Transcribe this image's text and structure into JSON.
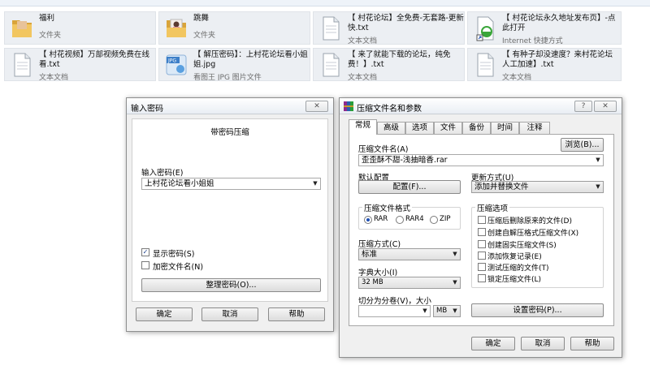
{
  "explorer": {
    "tiles": [
      {
        "name": "福利",
        "type": "文件夹",
        "icon": "folder-icon"
      },
      {
        "name": "跳舞",
        "type": "文件夹",
        "icon": "folder-photo-icon"
      },
      {
        "name": "【 村花论坛】全免费-无套路-更新快.txt",
        "type": "文本文档",
        "icon": "text-file-icon"
      },
      {
        "name": "【 村花论坛永久地址发布页】-点此打开",
        "type": "Internet 快捷方式",
        "icon": "internet-shortcut-icon"
      },
      {
        "name": "【 村花视频】万部视频免费在线看.txt",
        "type": "文本文档",
        "icon": "text-file-icon"
      },
      {
        "name": "【 解压密码】：上村花论坛看小姐姐.jpg",
        "type": "看图王 JPG 图片文件",
        "icon": "jpg-image-icon"
      },
      {
        "name": "【 来了就能下载的论坛，纯免费！】.txt",
        "type": "文本文档",
        "icon": "text-file-icon"
      },
      {
        "name": "【 有种子却没速度？来村花论坛人工加速】.txt",
        "type": "文本文档",
        "icon": "text-file-icon"
      }
    ]
  },
  "password_dialog": {
    "title": "输入密码",
    "close": "✕",
    "subtitle": "带密码压缩",
    "enter_label": "输入密码(E)",
    "password_value": "上村花论坛看小姐姐",
    "show_password": "显示密码(S)",
    "encrypt_filenames": "加密文件名(N)",
    "manage_button": "整理密码(O)...",
    "ok": "确定",
    "cancel": "取消",
    "help": "帮助"
  },
  "archive_dialog": {
    "title": "压缩文件名和参数",
    "help_icon": "?",
    "close": "✕",
    "tabs": [
      "常规",
      "高级",
      "选项",
      "文件",
      "备份",
      "时间",
      "注释"
    ],
    "archive_name_label": "压缩文件名(A)",
    "browse": "浏览(B)...",
    "archive_name": "歪歪酥不甜-浅抽暗香.rar",
    "default_profile_label": "默认配置",
    "profile_button": "配置(F)...",
    "update_mode_label": "更新方式(U)",
    "update_mode": "添加并替换文件",
    "format_label": "压缩文件格式",
    "formats": [
      "RAR",
      "RAR4",
      "ZIP"
    ],
    "method_label": "压缩方式(C)",
    "method": "标准",
    "dict_label": "字典大小(I)",
    "dict": "32 MB",
    "split_label": "切分为分卷(V)，大小",
    "split_value": "",
    "split_unit": "MB",
    "options_label": "压缩选项",
    "options": [
      "压缩后删除原来的文件(D)",
      "创建自解压格式压缩文件(X)",
      "创建固实压缩文件(S)",
      "添加恢复记录(E)",
      "测试压缩的文件(T)",
      "锁定压缩文件(L)"
    ],
    "set_password": "设置密码(P)...",
    "ok": "确定",
    "cancel": "取消",
    "help": "帮助"
  }
}
